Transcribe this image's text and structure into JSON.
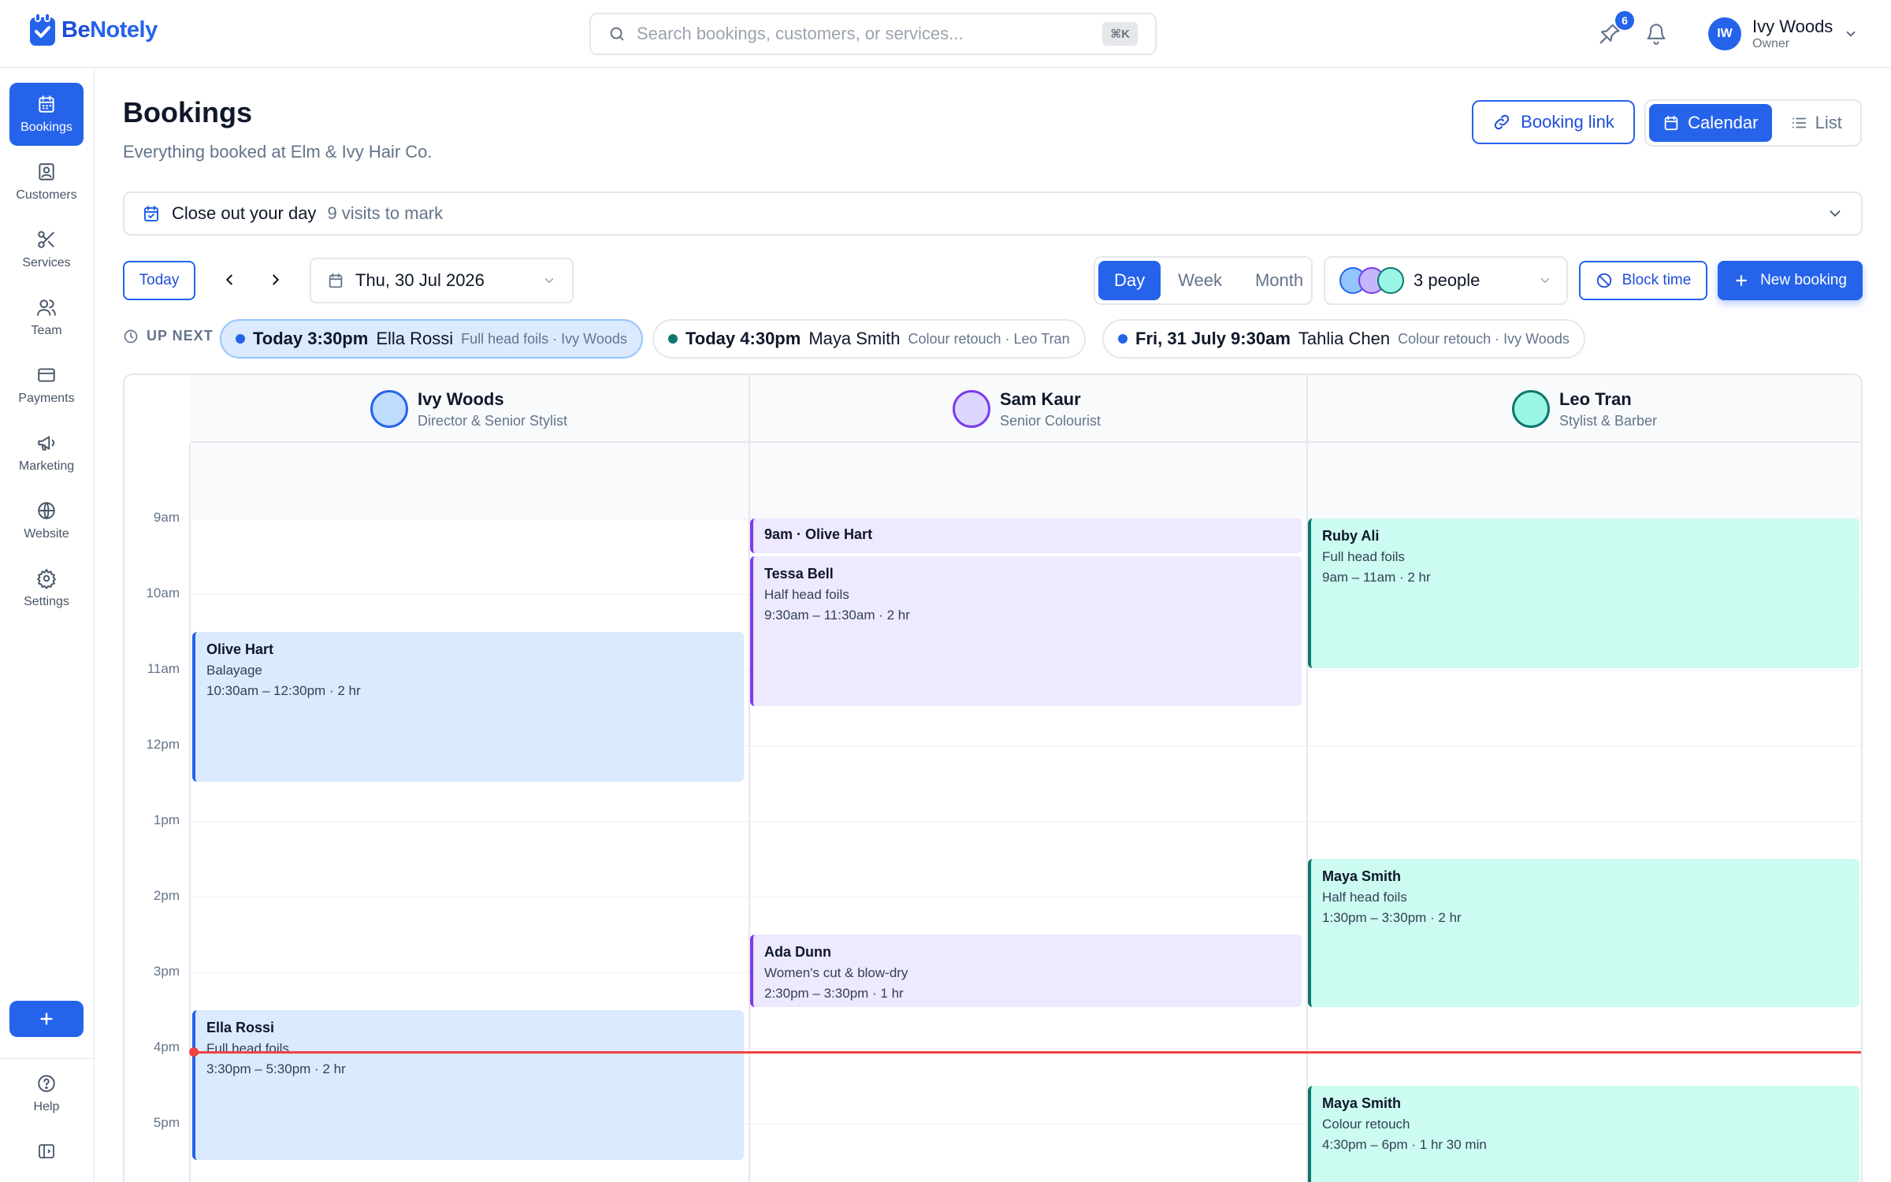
{
  "app": {
    "logo_be": "Be",
    "logo_notely": "Notely"
  },
  "search": {
    "placeholder": "Search bookings, customers, or services...",
    "shortcut": "⌘K"
  },
  "topbar": {
    "notif_count": "6"
  },
  "user": {
    "initials": "IW",
    "name": "Ivy Woods",
    "role": "Owner"
  },
  "sidebar": {
    "items": [
      {
        "label": "Bookings",
        "icon": "calendar-icon"
      },
      {
        "label": "Customers",
        "icon": "contact-icon"
      },
      {
        "label": "Services",
        "icon": "scissors-icon"
      },
      {
        "label": "Team",
        "icon": "users-icon"
      },
      {
        "label": "Payments",
        "icon": "card-icon"
      },
      {
        "label": "Marketing",
        "icon": "megaphone-icon"
      },
      {
        "label": "Website",
        "icon": "globe-icon"
      },
      {
        "label": "Settings",
        "icon": "gear-icon"
      }
    ],
    "help": "Help"
  },
  "page": {
    "title": "Bookings",
    "subtitle": "Everything booked at Elm & Ivy Hair Co."
  },
  "header_actions": {
    "booking_link": "Booking link",
    "calendar": "Calendar",
    "list": "List"
  },
  "closeout": {
    "title": "Close out your day",
    "count": "9 visits to mark"
  },
  "toolbar": {
    "today": "Today",
    "date": "Thu, 30 Jul 2026",
    "views": [
      "Day",
      "Week",
      "Month"
    ],
    "people": "3 people",
    "block_time": "Block time",
    "new_booking": "New booking"
  },
  "upnext": {
    "label": "UP NEXT",
    "chips": [
      {
        "when": "Today 3:30pm",
        "who": "Ella Rossi",
        "what": "Full head foils · Ivy Woods",
        "color": "#2563eb"
      },
      {
        "when": "Today 4:30pm",
        "who": "Maya Smith",
        "what": "Colour retouch · Leo Tran",
        "color": "#0f766e"
      },
      {
        "when": "Fri, 31 July 9:30am",
        "who": "Tahlia Chen",
        "what": "Colour retouch · Ivy Woods",
        "color": "#2563eb"
      }
    ]
  },
  "calendar": {
    "staff": [
      {
        "name": "Ivy Woods",
        "role": "Director & Senior Stylist",
        "color": "#2563eb"
      },
      {
        "name": "Sam Kaur",
        "role": "Senior Colourist",
        "color": "#7c3aed"
      },
      {
        "name": "Leo Tran",
        "role": "Stylist & Barber",
        "color": "#0f766e"
      }
    ],
    "hours": [
      "9am",
      "10am",
      "11am",
      "12pm",
      "1pm",
      "2pm",
      "3pm",
      "4pm",
      "5pm"
    ],
    "events": {
      "ivy": [
        {
          "name": "Olive Hart",
          "service": "Balayage",
          "time": "10:30am – 12:30pm · 2 hr"
        },
        {
          "name": "Ella Rossi",
          "service": "Full head foils",
          "time": "3:30pm – 5:30pm · 2 hr"
        }
      ],
      "sam": [
        {
          "name": "9am · Olive Hart"
        },
        {
          "name": "Tessa Bell",
          "service": "Half head foils",
          "time": "9:30am – 11:30am · 2 hr"
        },
        {
          "name": "Ada Dunn",
          "service": "Women's cut & blow-dry",
          "time": "2:30pm – 3:30pm · 1 hr"
        }
      ],
      "leo": [
        {
          "name": "Ruby Ali",
          "service": "Full head foils",
          "time": "9am – 11am · 2 hr"
        },
        {
          "name": "Maya Smith",
          "service": "Half head foils",
          "time": "1:30pm – 3:30pm · 2 hr"
        },
        {
          "name": "Maya Smith",
          "service": "Colour retouch",
          "time": "4:30pm – 6pm · 1 hr 30 min"
        }
      ]
    }
  }
}
